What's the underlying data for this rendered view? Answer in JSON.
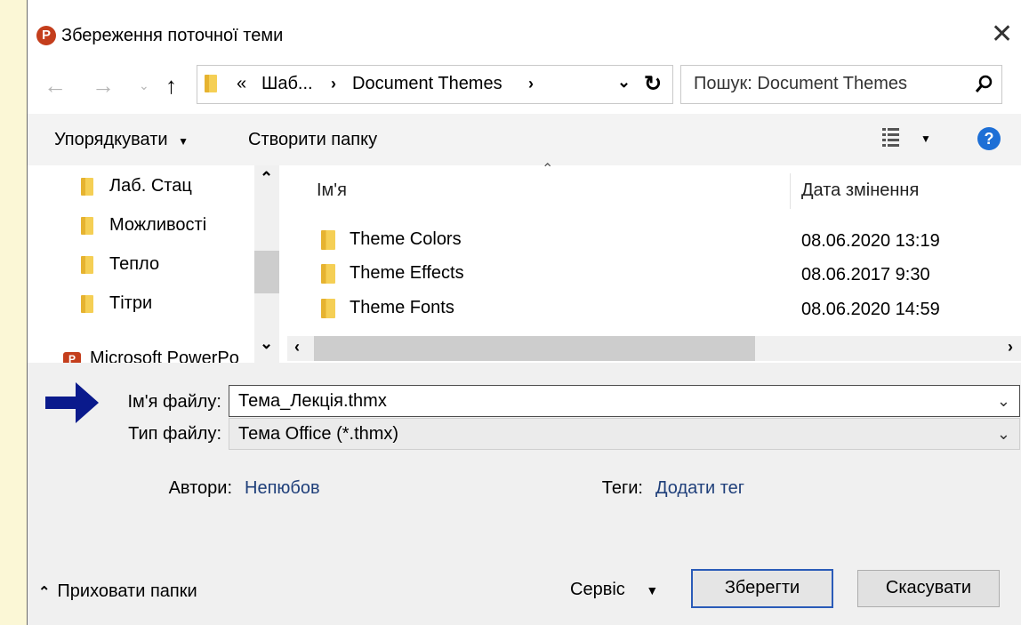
{
  "window": {
    "title": "Збереження поточної теми",
    "app_badge": "P"
  },
  "nav": {
    "back_icon": "arrow-left-icon",
    "forward_icon": "arrow-right-icon",
    "recent_icon": "chevron-down-icon",
    "up_icon": "arrow-up-icon",
    "address": {
      "overflow": "«",
      "parent": "Шаб...",
      "current": "Document Themes"
    },
    "search_placeholder": "Пошук: Document Themes"
  },
  "toolbar": {
    "organize_label": "Упорядкувати",
    "new_folder_label": "Створити папку"
  },
  "sidebar": {
    "items": [
      {
        "label": "Лаб. Стац"
      },
      {
        "label": "Можливості"
      },
      {
        "label": "Тепло"
      },
      {
        "label": "Тітри"
      }
    ],
    "app_item": {
      "label": "Microsoft PowerPo",
      "badge": "P"
    }
  },
  "file_list": {
    "columns": {
      "name": "Ім'я",
      "date": "Дата змінення"
    },
    "rows": [
      {
        "name": "Theme Colors",
        "date": "08.06.2020 13:19"
      },
      {
        "name": "Theme Effects",
        "date": "08.06.2017 9:30"
      },
      {
        "name": "Theme Fonts",
        "date": "08.06.2020 14:59"
      }
    ]
  },
  "form": {
    "filename_label": "Ім'я файлу:",
    "filename_value": "Тема_Лекція.thmx",
    "filetype_label": "Тип файлу:",
    "filetype_value": "Тема Office (*.thmx)",
    "authors_label": "Автори:",
    "authors_value": "Непюбов",
    "tags_label": "Теги:",
    "tags_value": "Додати тег"
  },
  "footer": {
    "hide_folders_label": "Приховати папки",
    "tools_label": "Сервіс",
    "save_label": "Зберегти",
    "cancel_label": "Скасувати"
  },
  "colors": {
    "annotation_arrow": "#0a1a8c",
    "accent": "#2a5bb8",
    "app_badge": "#c43e1c",
    "page_background": "#fbf7d6"
  }
}
